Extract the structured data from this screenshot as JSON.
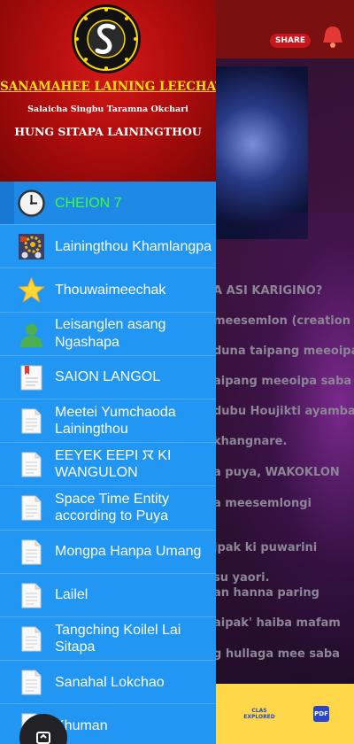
{
  "background": {
    "share_label": "SHARE",
    "lines": [
      "A ASI KARIGINO?",
      "meesemlon (creation of",
      "duna taipang meeoipa",
      "aipang meeoipa saba",
      "dubu Houjikti ayamba",
      "khangnare.",
      "a puya, WAKOKLON",
      "a meesemlongi",
      "ipak ki puwarini",
      "su yaori.",
      "an hanna paring",
      "aipak' haiba mafam",
      "g hullaga mee saba"
    ],
    "bottom_label": "CLAS\nEXPLORED",
    "pdf_label": "PDF"
  },
  "drawer": {
    "title": "SANAMAHEE LAINING LEECHAT",
    "subtitle": "Salaicha Singbu Taramna Okchari",
    "tagline": "HUNG SITAPA LAININGTHOU",
    "items": [
      {
        "label": "CHEION 7",
        "icon": "clock-icon",
        "selected": true
      },
      {
        "label": "Lainingthou Khamlangpa",
        "icon": "gear-machine-icon"
      },
      {
        "label": "Thouwaimeechak",
        "icon": "star-icon"
      },
      {
        "label": "Leisanglen asang Ngashapa",
        "icon": "person-icon"
      },
      {
        "label": "SAION LANGOL",
        "icon": "bookmark-doc-icon"
      },
      {
        "label": "Meetei Yumchaoda Lainingthou",
        "icon": "document-icon"
      },
      {
        "label": "EEYEK EEPI ꯋ KI WANGULON",
        "icon": "document-icon"
      },
      {
        "label": "Space Time Entity according to Puya",
        "icon": "document-icon"
      },
      {
        "label": "Mongpa Hanpa Umang",
        "icon": "document-icon"
      },
      {
        "label": "Lailel",
        "icon": "document-icon"
      },
      {
        "label": "Tangching Koilel Lai Sitapa",
        "icon": "document-icon"
      },
      {
        "label": "Sanahal Lokchao",
        "icon": "document-icon"
      },
      {
        "label": "Khuman",
        "icon": "document-icon"
      }
    ]
  },
  "colors": {
    "drawer_bg": "#2196f3",
    "header_red": "#b10d0d",
    "title_yellow": "#ffe000",
    "selected_text": "#39ff3a"
  }
}
